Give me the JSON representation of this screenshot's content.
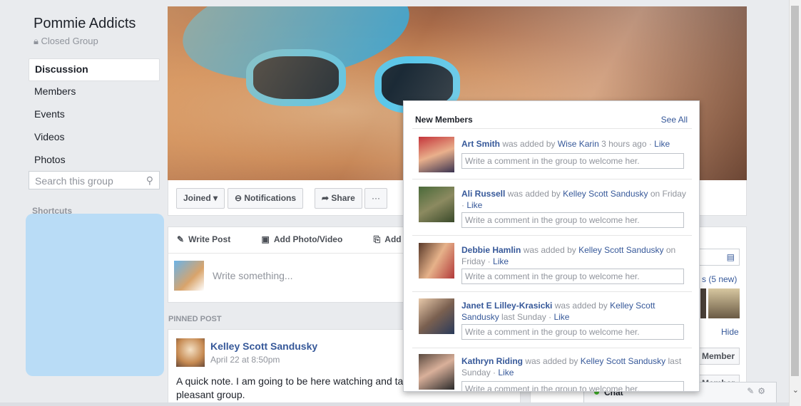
{
  "group": {
    "name": "Pommie Addicts",
    "privacy": "Closed Group",
    "nav": [
      "Discussion",
      "Members",
      "Events",
      "Videos",
      "Photos"
    ],
    "search_placeholder": "Search this group",
    "shortcuts_label": "Shortcuts"
  },
  "actions": {
    "joined": "Joined ▾",
    "notifications": "Notifications",
    "share": "Share",
    "more": "···"
  },
  "composer": {
    "write_post": "Write Post",
    "add_photo": "Add Photo/Video",
    "add_file": "Add File",
    "placeholder": "Write something..."
  },
  "pinned": {
    "label": "PINNED POST",
    "author": "Kelley Scott Sandusky",
    "time": "April 22 at 8:50pm",
    "text": "A quick note. I am going to be here watching and tal",
    "text2": "pleasant group."
  },
  "right_column": {
    "new_count": "s (5 new)",
    "hide": "Hide",
    "member_btn": "Member",
    "member_btn2": "Member"
  },
  "chat": {
    "label": "Chat"
  },
  "popup": {
    "title": "New Members",
    "see_all": "See All",
    "comment_placeholder": "Write a comment in the group to welcome her.",
    "members": [
      {
        "name": "Art Smith",
        "added_by": "Wise Karin",
        "when": "3 hours ago",
        "like": "Like"
      },
      {
        "name": "Ali Russell",
        "added_by": "Kelley Scott Sandusky",
        "when": "on Friday",
        "like": "Like"
      },
      {
        "name": "Debbie Hamlin",
        "added_by": "Kelley Scott Sandusky",
        "when": "on Friday",
        "like": "Like"
      },
      {
        "name": "Janet E Lilley-Krasicki",
        "added_by": "Kelley Scott Sandusky",
        "when": "last Sunday",
        "like": "Like"
      },
      {
        "name": "Kathryn Riding",
        "added_by": "Kelley Scott Sandusky",
        "when": "last Sunday",
        "like": "Like"
      }
    ],
    "was_added_by": "was added by"
  }
}
